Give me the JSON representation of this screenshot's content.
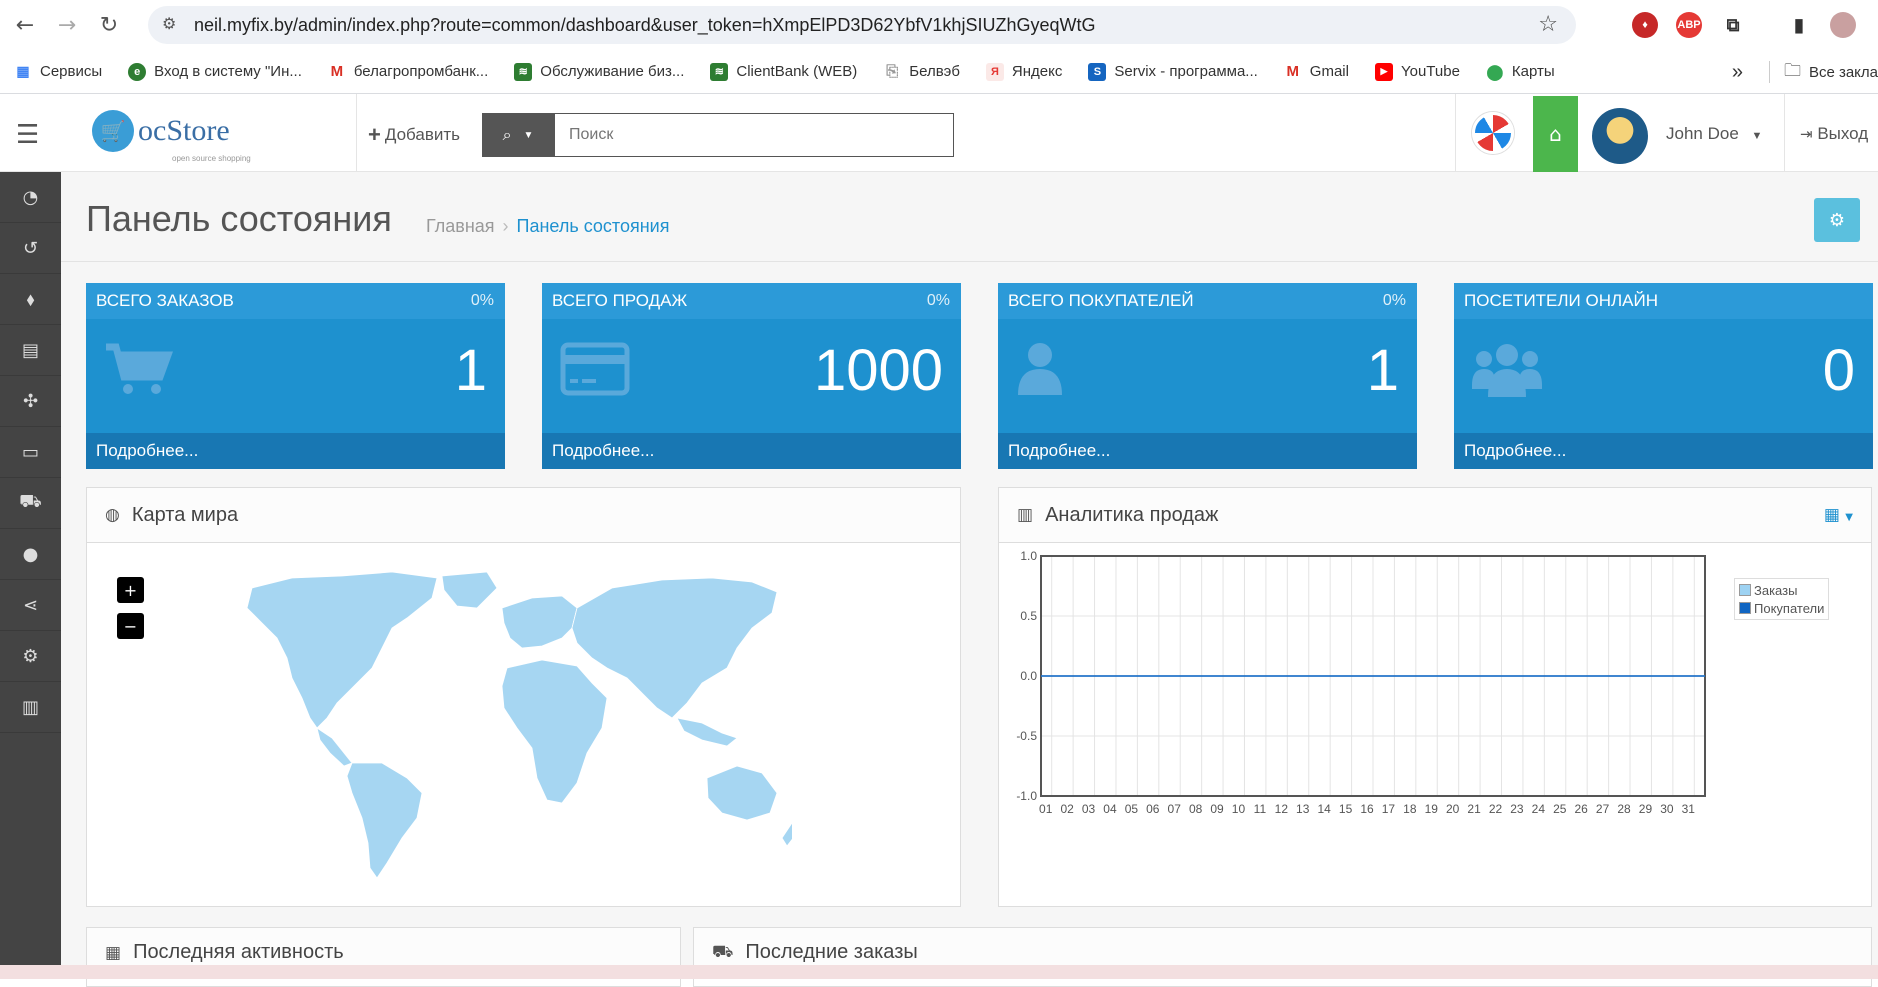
{
  "browser": {
    "url": "neil.myfix.by/admin/index.php?route=common/dashboard&user_token=hXmpElPD3D62YbfV1khjSIUZhGyeqWtG",
    "bookmarks": [
      {
        "label": "Сервисы",
        "icon": "apps-grid-icon",
        "color": "#4285f4"
      },
      {
        "label": "Вход в систему \"Ин...",
        "icon": "globe-icon",
        "color": "#2e7d32"
      },
      {
        "label": "белагропромбанк...",
        "icon": "gmail-icon",
        "color": "#d93025"
      },
      {
        "label": "Обслуживание биз...",
        "icon": "bank-icon",
        "color": "#2e7d32"
      },
      {
        "label": "ClientBank (WEB)",
        "icon": "bank-icon",
        "color": "#2e7d32"
      },
      {
        "label": "Белвэб",
        "icon": "page-icon",
        "color": "#9e9e9e"
      },
      {
        "label": "Яндекс",
        "icon": "yandex-icon",
        "color": "#e53935"
      },
      {
        "label": "Servix - программа...",
        "icon": "servix-icon",
        "color": "#1565c0"
      },
      {
        "label": "Gmail",
        "icon": "gmail-icon",
        "color": "#d93025"
      },
      {
        "label": "YouTube",
        "icon": "youtube-icon",
        "color": "#ff0000"
      },
      {
        "label": "Карты",
        "icon": "maps-pin-icon",
        "color": "#34a853"
      }
    ],
    "more": "»",
    "all_bookmarks": "Все закла"
  },
  "header": {
    "logo_text": "ocStore",
    "logo_sub": "open source shopping",
    "add_label": "Добавить",
    "search_placeholder": "Поиск",
    "user_name": "John Doe",
    "logout_label": "Выход"
  },
  "page": {
    "title": "Панель состояния",
    "breadcrumb": [
      "Главная",
      "Панель состояния"
    ]
  },
  "tiles": [
    {
      "title": "Всего заказов",
      "pct": "0%",
      "value": "1",
      "more": "Подробнее...",
      "icon": "cart-icon"
    },
    {
      "title": "Всего продаж",
      "pct": "0%",
      "value": "1000",
      "more": "Подробнее...",
      "icon": "credit-card-icon"
    },
    {
      "title": "Всего покупателей",
      "pct": "0%",
      "value": "1",
      "more": "Подробнее...",
      "icon": "user-icon"
    },
    {
      "title": "Посетители онлайн",
      "pct": "",
      "value": "0",
      "more": "Подробнее...",
      "icon": "users-icon"
    }
  ],
  "map_panel": {
    "title": "Карта мира",
    "zoom_in": "+",
    "zoom_out": "−"
  },
  "analytics_panel": {
    "title": "Аналитика продаж"
  },
  "bottom_panels": {
    "activity": "Последняя активность",
    "orders": "Последние заказы"
  },
  "colors": {
    "primary": "#1e91cf",
    "tile_footer": "#1877b3",
    "sidebar": "#444444",
    "home": "#4cb64c",
    "settings": "#5bc0de"
  },
  "chart_data": {
    "type": "line",
    "x": [
      "01",
      "02",
      "03",
      "04",
      "05",
      "06",
      "07",
      "08",
      "09",
      "10",
      "11",
      "12",
      "13",
      "14",
      "15",
      "16",
      "17",
      "18",
      "19",
      "20",
      "21",
      "22",
      "23",
      "24",
      "25",
      "26",
      "27",
      "28",
      "29",
      "30",
      "31"
    ],
    "series": [
      {
        "name": "Заказы",
        "color": "#9dd2f2",
        "values": [
          0,
          0,
          0,
          0,
          0,
          0,
          0,
          0,
          0,
          0,
          0,
          0,
          0,
          0,
          0,
          0,
          0,
          0,
          0,
          0,
          0,
          0,
          0,
          0,
          0,
          0,
          0,
          0,
          0,
          0,
          0
        ]
      },
      {
        "name": "Покупатели",
        "color": "#1065c2",
        "values": [
          0,
          0,
          0,
          0,
          0,
          0,
          0,
          0,
          0,
          0,
          0,
          0,
          0,
          0,
          0,
          0,
          0,
          0,
          0,
          0,
          0,
          0,
          0,
          0,
          0,
          0,
          0,
          0,
          0,
          0,
          0
        ]
      }
    ],
    "y_ticks": [
      "1.0",
      "0.5",
      "0.0",
      "-0.5",
      "-1.0"
    ],
    "ylim": [
      -1,
      1
    ],
    "grid": true,
    "legend_position": "top-right"
  }
}
